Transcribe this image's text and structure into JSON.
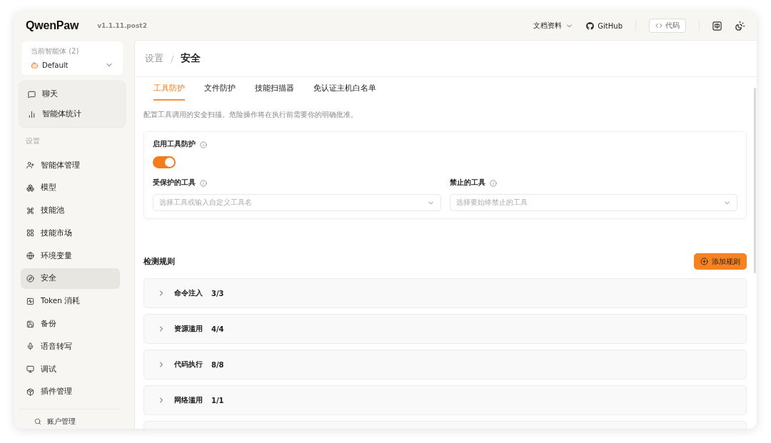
{
  "app": {
    "logo": "QwenPaw",
    "version": "v1.1.11.post2"
  },
  "header": {
    "docs": "文档资料",
    "github": "GitHub",
    "code": "代码"
  },
  "sidebar": {
    "agent": {
      "label": "当前智能体 (2)",
      "name": "Default"
    },
    "top_items": [
      {
        "label": "聊天"
      },
      {
        "label": "智能体统计"
      }
    ],
    "section": "设置",
    "items": [
      {
        "label": "智能体管理",
        "selected": false
      },
      {
        "label": "模型",
        "selected": false
      },
      {
        "label": "技能池",
        "selected": false
      },
      {
        "label": "技能市场",
        "selected": false
      },
      {
        "label": "环境变量",
        "selected": false
      },
      {
        "label": "安全",
        "selected": true
      },
      {
        "label": "Token 消耗",
        "selected": false
      },
      {
        "label": "备份",
        "selected": false
      },
      {
        "label": "语音转写",
        "selected": false
      },
      {
        "label": "调试",
        "selected": false
      },
      {
        "label": "插件管理",
        "selected": false
      }
    ],
    "footer": "账户管理"
  },
  "breadcrumb": {
    "parent": "设置",
    "separator": "/",
    "current": "安全"
  },
  "tabs": [
    {
      "label": "工具防护",
      "selected": true
    },
    {
      "label": "文件防护",
      "selected": false
    },
    {
      "label": "技能扫描器",
      "selected": false
    },
    {
      "label": "免认证主机白名单",
      "selected": false
    }
  ],
  "description": "配置工具调用的安全扫描。危险操作将在执行前需要你的明确批准。",
  "tool_guard": {
    "label": "启用工具防护",
    "on": true,
    "protected": {
      "label": "受保护的工具",
      "placeholder": "选择工具或输入自定义工具名"
    },
    "blocked": {
      "label": "禁止的工具",
      "placeholder": "选择要始终禁止的工具"
    }
  },
  "rules": {
    "title": "检测规则",
    "add_button": "添加规则",
    "items": [
      {
        "name": "命令注入",
        "count": "3/3",
        "expanded": false
      },
      {
        "name": "资源滥用",
        "count": "4/4",
        "expanded": false
      },
      {
        "name": "代码执行",
        "count": "8/8",
        "expanded": false
      },
      {
        "name": "网络滥用",
        "count": "1/1",
        "expanded": false
      }
    ]
  }
}
